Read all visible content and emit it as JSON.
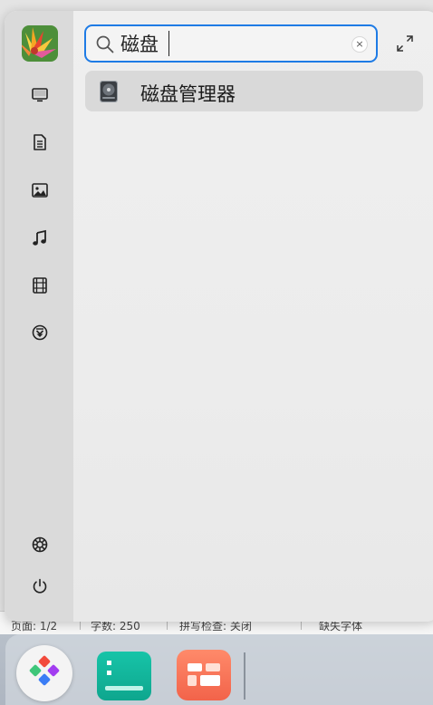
{
  "background_status": {
    "cells": [
      "页面: 1/2",
      "字数: 250",
      "拼写检查: 关闭",
      "缺失字体"
    ]
  },
  "launcher": {
    "sidebar": {
      "items": [
        {
          "name": "computer",
          "icon": "monitor-icon"
        },
        {
          "name": "documents",
          "icon": "document-icon"
        },
        {
          "name": "pictures",
          "icon": "image-icon"
        },
        {
          "name": "music",
          "icon": "music-note-icon"
        },
        {
          "name": "videos",
          "icon": "film-icon"
        },
        {
          "name": "downloads",
          "icon": "download-icon"
        }
      ],
      "bottom": [
        {
          "name": "settings",
          "icon": "settings-gear-icon"
        },
        {
          "name": "power",
          "icon": "power-icon"
        }
      ]
    },
    "search": {
      "value": "磁盘",
      "placeholder": ""
    },
    "results": [
      {
        "label": "磁盘管理器",
        "icon": "disk-manager-icon"
      }
    ],
    "accent_color": "#1e7be5"
  },
  "dock": {
    "apps": [
      {
        "name": "start-menu",
        "icon": "launcher-icon"
      },
      {
        "name": "app-1",
        "icon": "teal-app-icon"
      },
      {
        "name": "app-2",
        "icon": "orange-app-icon"
      }
    ]
  }
}
